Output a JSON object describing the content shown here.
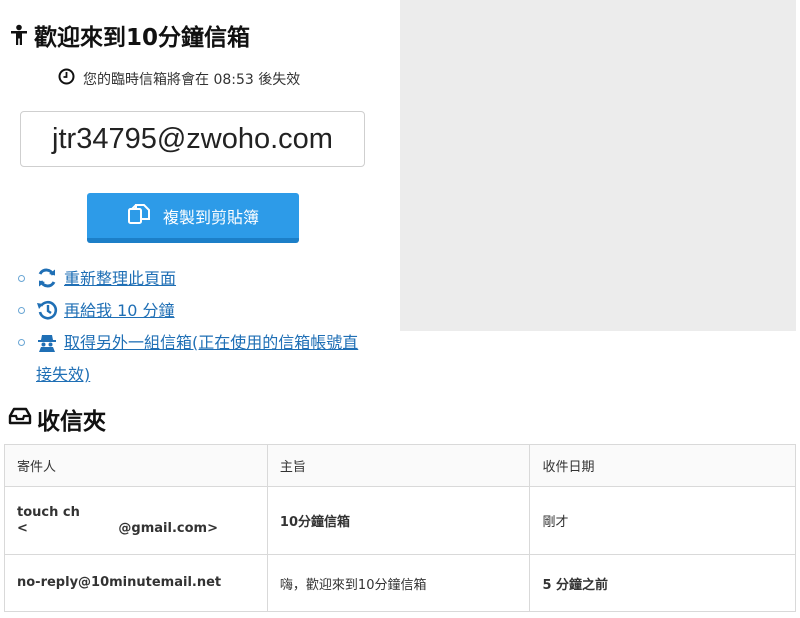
{
  "header": {
    "title": "歡迎來到10分鐘信箱",
    "expire_text": "您的臨時信箱將會在 08:53 後失效"
  },
  "email": {
    "address": "jtr34795@zwoho.com"
  },
  "copy_button": {
    "label": "複製到剪貼簿"
  },
  "actions": [
    {
      "label": "重新整理此頁面",
      "icon": "refresh-icon"
    },
    {
      "label": "再給我 10 分鐘",
      "icon": "history-icon"
    },
    {
      "label": "取得另外一組信箱(正在使用的信箱帳號直接失效)",
      "icon": "spy-icon"
    }
  ],
  "inbox": {
    "title": "收信夾",
    "columns": [
      "寄件人",
      "主旨",
      "收件日期"
    ],
    "rows": [
      {
        "sender_line1": "touch ch",
        "sender_line2": "<                    @gmail.com>",
        "subject": "10分鐘信箱",
        "date": "剛才"
      },
      {
        "sender_line1": "no-reply@10minutemail.net",
        "sender_line2": "",
        "subject": "嗨，歡迎來到10分鐘信箱",
        "date": "5 分鐘之前"
      }
    ]
  }
}
